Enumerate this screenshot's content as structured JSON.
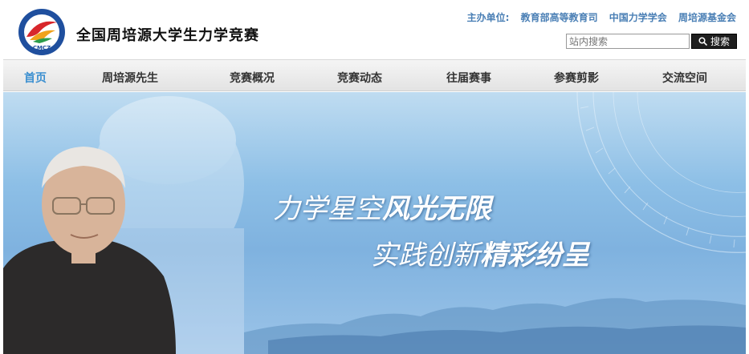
{
  "header": {
    "site_title": "全国周培源大学生力学竞赛",
    "sponsors_label": "主办单位:",
    "sponsors": [
      "教育部高等教育司",
      "中国力学学会",
      "周培源基金会"
    ]
  },
  "search": {
    "placeholder": "站内搜索",
    "button_label": "搜索"
  },
  "nav": {
    "items": [
      "首页",
      "周培源先生",
      "竞赛概况",
      "竞赛动态",
      "往届赛事",
      "参赛剪影",
      "交流空间"
    ],
    "active": "首页"
  },
  "banner": {
    "line1_normal": "力学星空",
    "line1_bold": "风光无限",
    "line2_normal": "实践创新",
    "line2_bold": "精彩纷呈"
  },
  "colors": {
    "accent": "#3b8fd0",
    "sponsor_text": "#4a7fb5"
  }
}
